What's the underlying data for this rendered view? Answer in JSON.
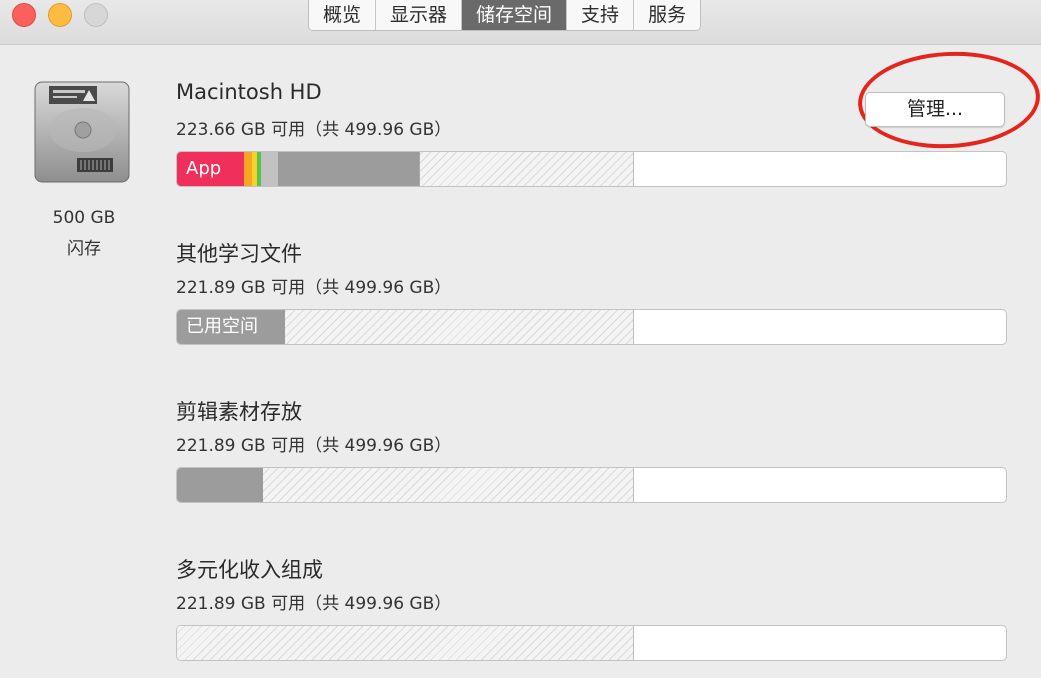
{
  "tabs": [
    {
      "label": "概览"
    },
    {
      "label": "显示器"
    },
    {
      "label": "储存空间"
    },
    {
      "label": "支持"
    },
    {
      "label": "服务"
    }
  ],
  "active_tab": "储存空间",
  "disk": {
    "capacity": "500 GB",
    "type": "闪存",
    "icon": "hard-drive-icon"
  },
  "manage_button": {
    "label": "管理..."
  },
  "volumes": [
    {
      "name": "Macintosh HD",
      "available": "223.66 GB 可用（共 499.96 GB）",
      "segment_label": "App"
    },
    {
      "name": "其他学习文件",
      "available": "221.89 GB 可用（共 499.96 GB）",
      "segment_label": "已用空间"
    },
    {
      "name": "剪辑素材存放",
      "available": "221.89 GB 可用（共 499.96 GB）"
    },
    {
      "name": "多元化收入组成",
      "available": "221.89 GB 可用（共 499.96 GB）"
    }
  ],
  "colors": {
    "apps": "#f0305a",
    "orange": "#f5a623",
    "yellow": "#f8d12c",
    "green": "#5ac24a",
    "gray_light": "#c2c2c2",
    "gray_dark": "#9c9c9c",
    "annotation": "#e5251b"
  }
}
